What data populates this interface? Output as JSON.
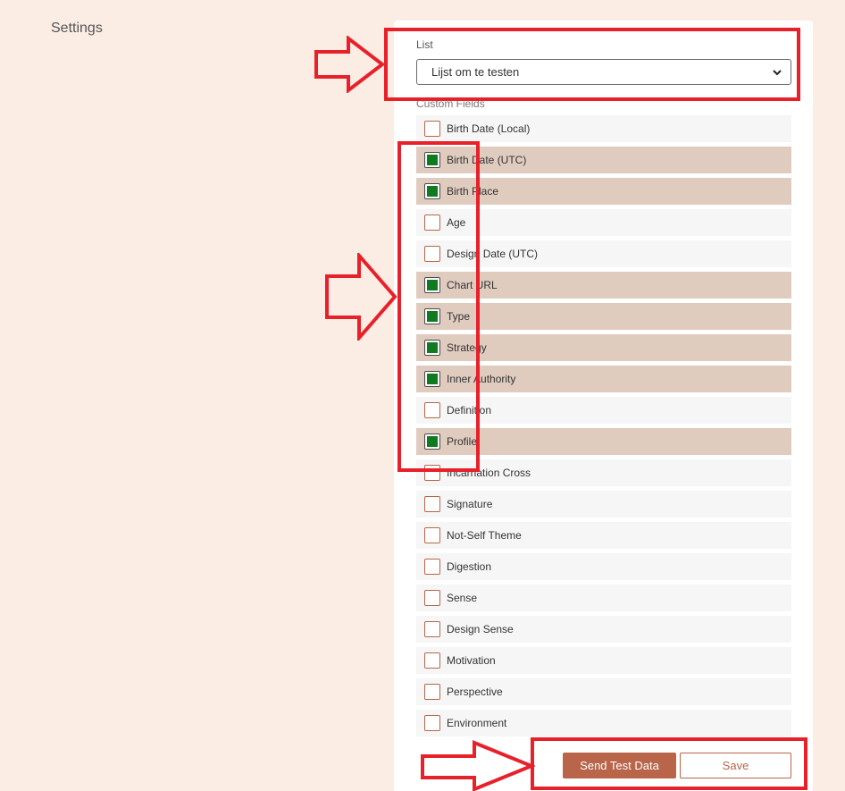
{
  "page": {
    "heading": "Settings"
  },
  "list": {
    "label": "List",
    "selected": "Lijst om te testen"
  },
  "custom_fields": {
    "label": "Custom Fields",
    "items": [
      {
        "label": "Birth Date (Local)",
        "checked": false
      },
      {
        "label": "Birth Date (UTC)",
        "checked": true
      },
      {
        "label": "Birth Place",
        "checked": true
      },
      {
        "label": "Age",
        "checked": false
      },
      {
        "label": "Design Date (UTC)",
        "checked": false
      },
      {
        "label": "Chart URL",
        "checked": true
      },
      {
        "label": "Type",
        "checked": true
      },
      {
        "label": "Strategy",
        "checked": true
      },
      {
        "label": "Inner Authority",
        "checked": true
      },
      {
        "label": "Definition",
        "checked": false
      },
      {
        "label": "Profile",
        "checked": true
      },
      {
        "label": "Incarnation Cross",
        "checked": false
      },
      {
        "label": "Signature",
        "checked": false
      },
      {
        "label": "Not-Self Theme",
        "checked": false
      },
      {
        "label": "Digestion",
        "checked": false
      },
      {
        "label": "Sense",
        "checked": false
      },
      {
        "label": "Design Sense",
        "checked": false
      },
      {
        "label": "Motivation",
        "checked": false
      },
      {
        "label": "Perspective",
        "checked": false
      },
      {
        "label": "Environment",
        "checked": false
      }
    ]
  },
  "actions": {
    "send_test_label": "Send Test Data",
    "save_label": "Save"
  },
  "colors": {
    "page_bg": "#fcede4",
    "accent": "#b8654a",
    "checked_row_bg": "#e0cbbf",
    "checkbox_fill": "#0f7a1f",
    "annotation_red": "#e8202a"
  },
  "icons": {
    "select_chevron": "chevron-down-icon",
    "annotation_arrow": "right-arrow-icon"
  }
}
